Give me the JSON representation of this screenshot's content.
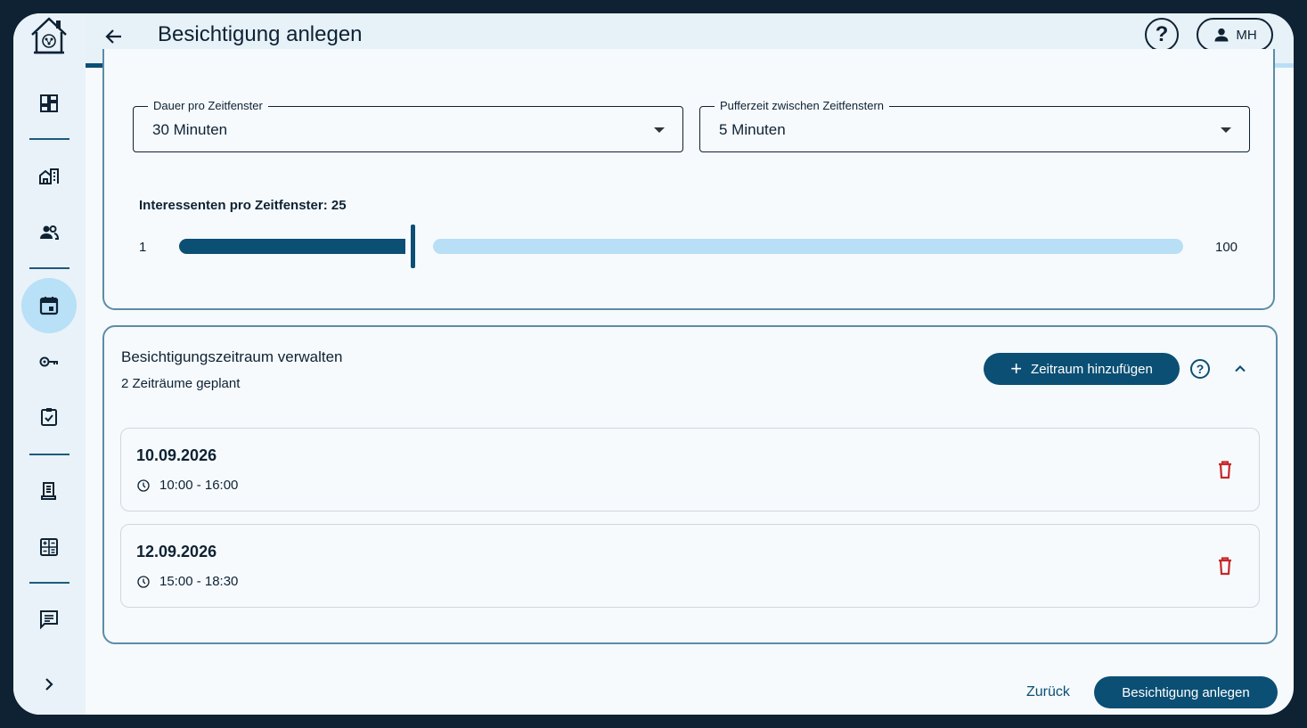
{
  "header": {
    "title": "Besichtigung anlegen",
    "help_label": "?",
    "user_initials": "MH",
    "progress_fraction": 0.797
  },
  "sidebar": {
    "items": [
      {
        "icon": "dashboard-icon"
      },
      {
        "icon": "properties-icon"
      },
      {
        "icon": "people-icon"
      },
      {
        "icon": "calendar-icon",
        "active": true
      },
      {
        "icon": "key-icon"
      },
      {
        "icon": "clipboard-check-icon"
      },
      {
        "icon": "document-icon"
      },
      {
        "icon": "calculator-icon"
      },
      {
        "icon": "chat-icon"
      },
      {
        "icon": "chevron-right-icon"
      }
    ]
  },
  "settings": {
    "duration": {
      "label": "Dauer pro Zeitfenster",
      "value": "30 Minuten"
    },
    "buffer": {
      "label": "Pufferzeit zwischen Zeitfenstern",
      "value": "5 Minuten"
    },
    "slider": {
      "label": "Interessenten pro Zeitfenster: 25",
      "min": "1",
      "max": "100",
      "value": 25,
      "min_value": 1,
      "max_value": 100
    }
  },
  "ranges": {
    "title": "Besichtigungszeitraum verwalten",
    "subtitle": "2 Zeiträume geplant",
    "add_label": "Zeitraum hinzufügen",
    "help_label": "?",
    "items": [
      {
        "date": "10.09.2026",
        "time": "10:00 - 16:00"
      },
      {
        "date": "12.09.2026",
        "time": "15:00 - 18:30"
      }
    ]
  },
  "footer": {
    "back_label": "Zurück",
    "submit_label": "Besichtigung anlegen"
  },
  "colors": {
    "primary": "#0b4f74",
    "light": "#b8dff5",
    "danger": "#c62828",
    "text": "#0e2233"
  }
}
